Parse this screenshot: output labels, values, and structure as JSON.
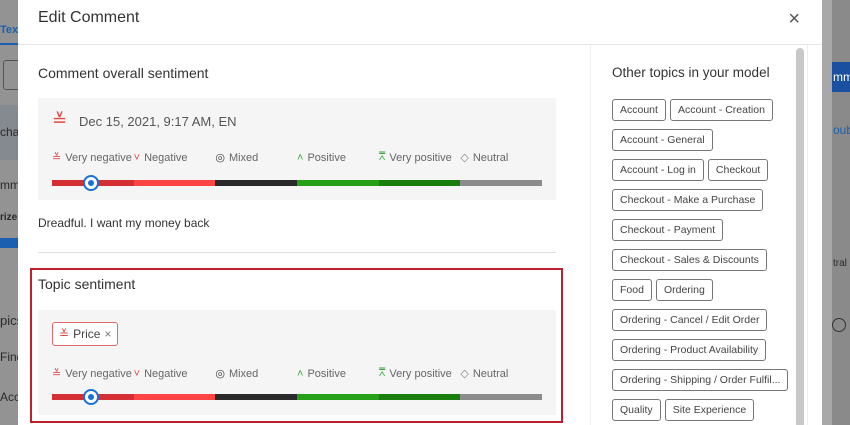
{
  "backdrop": {
    "left": [
      "Tex",
      "cha",
      "mm",
      "rize",
      "pics",
      "Find",
      "Acc"
    ],
    "right": [
      "mm",
      "oub",
      "tral"
    ]
  },
  "modal": {
    "title": "Edit Comment",
    "close_label": "×"
  },
  "overall": {
    "heading": "Comment overall sentiment",
    "meta": "Dec 15, 2021, 9:17 AM, EN",
    "comment": "Dreadful. I want my money back",
    "selected": "Very negative"
  },
  "topic": {
    "heading": "Topic sentiment",
    "tag": "Price",
    "tag_remove": "×",
    "selected": "Very negative"
  },
  "scale": [
    {
      "label": "Very negative",
      "icon": "very-negative-icon",
      "glyph": "≚",
      "color": "#d42f34",
      "icon_color": "#e04848"
    },
    {
      "label": "Negative",
      "icon": "negative-icon",
      "glyph": "˅",
      "color": "#ff4444",
      "icon_color": "#e04848"
    },
    {
      "label": "Mixed",
      "icon": "mixed-icon",
      "glyph": "◎",
      "color": "#2a2a2a",
      "icon_color": "#444"
    },
    {
      "label": "Positive",
      "icon": "positive-icon",
      "glyph": "˄",
      "color": "#25a018",
      "icon_color": "#3aa83a"
    },
    {
      "label": "Very positive",
      "icon": "very-positive-icon",
      "glyph": "⩞",
      "color": "#1a7e0f",
      "icon_color": "#3aa83a"
    },
    {
      "label": "Neutral",
      "icon": "neutral-icon",
      "glyph": "◇",
      "color": "#8c8c8c",
      "icon_color": "#888"
    }
  ],
  "other_topics": {
    "heading": "Other topics in your model",
    "items": [
      "Account",
      "Account - Creation",
      "Account - General",
      "Account - Log in",
      "Checkout",
      "Checkout - Make a Purchase",
      "Checkout - Payment",
      "Checkout - Sales & Discounts",
      "Food",
      "Ordering",
      "Ordering - Cancel / Edit Order",
      "Ordering - Product Availability",
      "Ordering - Shipping / Order Fulfil...",
      "Quality",
      "Site Experience"
    ]
  }
}
